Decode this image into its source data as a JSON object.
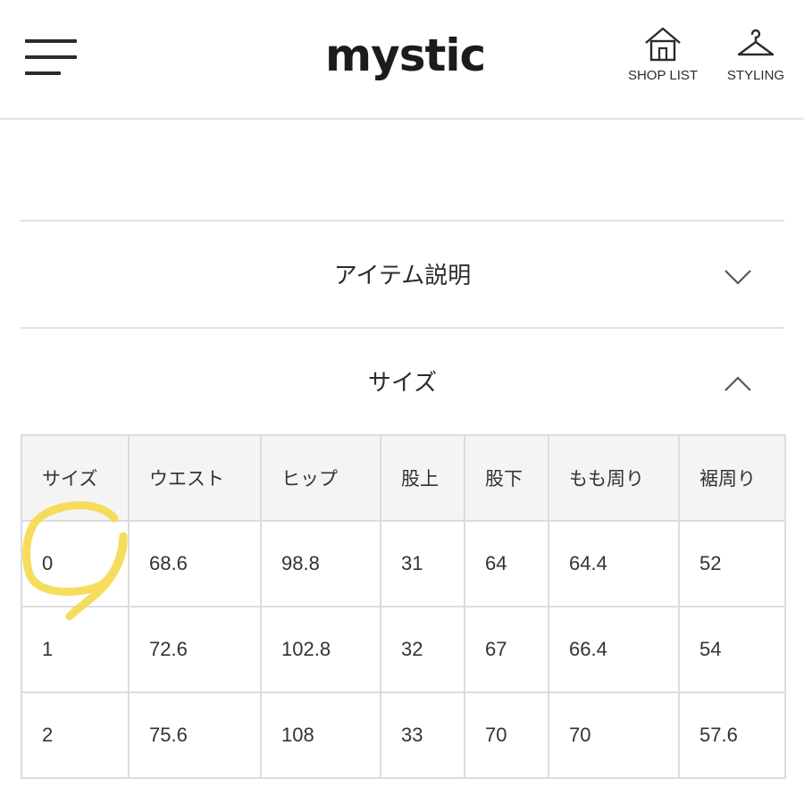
{
  "header": {
    "logo": "mystic",
    "shop_list_label": "SHOP LIST",
    "styling_label": "STYLING"
  },
  "accordion": {
    "item_description": "アイテム説明",
    "size": "サイズ"
  },
  "size_table": {
    "headers": [
      "サイズ",
      "ウエスト",
      "ヒップ",
      "股上",
      "股下",
      "もも周り",
      "裾周り"
    ],
    "rows": [
      [
        "0",
        "68.6",
        "98.8",
        "31",
        "64",
        "64.4",
        "52"
      ],
      [
        "1",
        "72.6",
        "102.8",
        "32",
        "67",
        "66.4",
        "54"
      ],
      [
        "2",
        "75.6",
        "108",
        "33",
        "70",
        "70",
        "57.6"
      ]
    ]
  },
  "colors": {
    "highlight": "#f5d742",
    "border": "#dcdcdc",
    "header_bg": "#f4f4f4",
    "text": "#2b2b2b"
  }
}
